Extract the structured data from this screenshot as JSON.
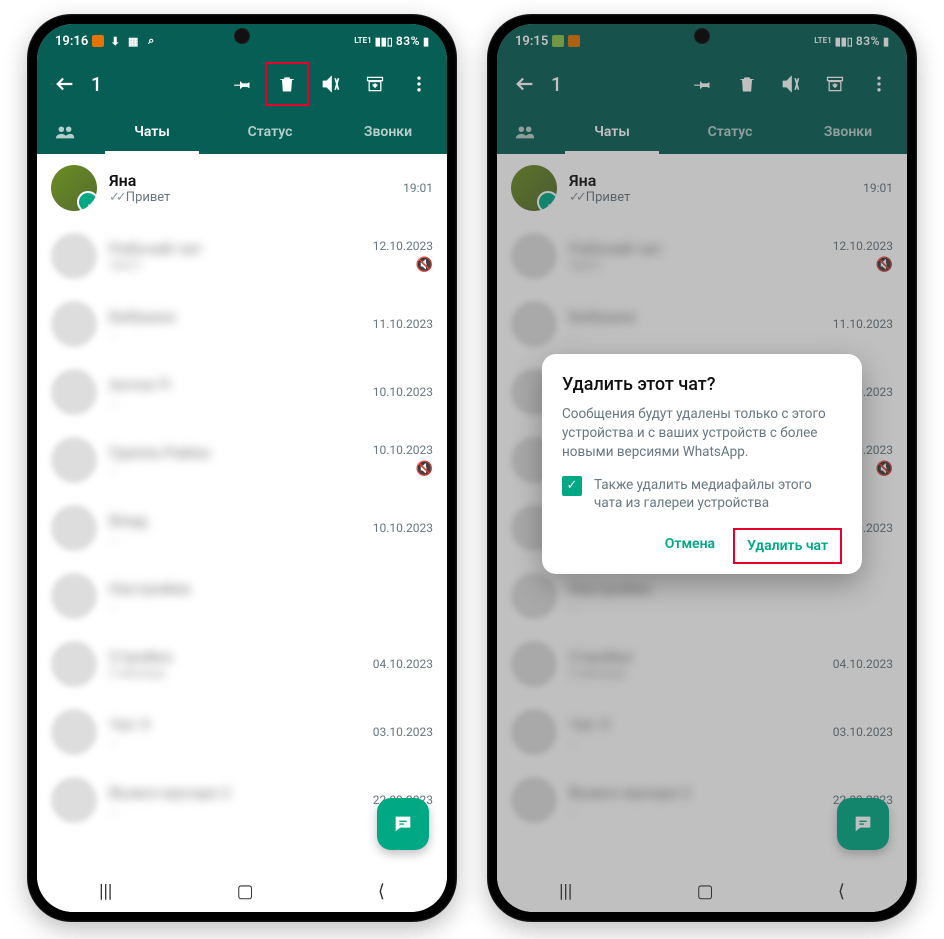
{
  "phones": [
    {
      "statusbar": {
        "time": "19:16",
        "battery": "83%",
        "net": "LTE1"
      },
      "selection_count": "1",
      "tabs": {
        "chats": "Чаты",
        "status": "Статус",
        "calls": "Звонки"
      },
      "highlight_delete": true,
      "chats": [
        {
          "name": "Яна",
          "msg": "Привет",
          "time": "19:01",
          "selected": true,
          "read": true
        },
        {
          "name": "Рабочий чат",
          "msg": "текст",
          "time": "12.10.2023",
          "muted": true,
          "blur": true
        },
        {
          "name": "Бабушка",
          "msg": "…",
          "time": "11.10.2023",
          "blur": true
        },
        {
          "name": "Антон П",
          "msg": "…",
          "time": "10.10.2023",
          "blur": true
        },
        {
          "name": "Группа Район",
          "msg": "…",
          "time": "10.10.2023",
          "muted": true,
          "blur": true
        },
        {
          "name": "Влад",
          "msg": "…",
          "time": "10.10.2023",
          "blur": true
        },
        {
          "name": "Настройки",
          "msg": "…",
          "time": "",
          "blur": true
        },
        {
          "name": "Стройка",
          "msg": "2 месяца",
          "time": "04.10.2023",
          "blur": true
        },
        {
          "name": "Чат 9",
          "msg": "…",
          "time": "03.10.2023",
          "blur": true
        },
        {
          "name": "Вывоз мусора 2",
          "msg": "…",
          "time": "22.09.2023",
          "blur": true
        }
      ]
    },
    {
      "statusbar": {
        "time": "19:15",
        "battery": "83%",
        "net": "LTE1"
      },
      "selection_count": "1",
      "tabs": {
        "chats": "Чаты",
        "status": "Статус",
        "calls": "Звонки"
      },
      "highlight_delete": false,
      "dialog": {
        "title": "Удалить этот чат?",
        "body": "Сообщения будут удалены только с этого устройства и с ваших устройств с более новыми версиями WhatsApp.",
        "checkbox": "Также удалить медиафайлы этого чата из галереи устройства",
        "cancel": "Отмена",
        "confirm": "Удалить чат"
      },
      "chats": [
        {
          "name": "Яна",
          "msg": "Привет",
          "time": "19:01",
          "selected": true,
          "read": true
        },
        {
          "name": "Рабочий чат",
          "msg": "текст",
          "time": "12.10.2023",
          "muted": true,
          "blur": true
        },
        {
          "name": "Бабушка",
          "msg": "…",
          "time": "11.10.2023",
          "blur": true
        },
        {
          "name": "Антон П",
          "msg": "…",
          "time": "10.10.2023",
          "blur": true
        },
        {
          "name": "Группа Район",
          "msg": "…",
          "time": "10.10.2023",
          "muted": true,
          "blur": true
        },
        {
          "name": "Влад",
          "msg": "…",
          "time": "10.10.2023",
          "blur": true
        },
        {
          "name": "Настройки",
          "msg": "…",
          "time": "",
          "blur": true
        },
        {
          "name": "Стройка",
          "msg": "2 месяца",
          "time": "04.10.2023",
          "blur": true
        },
        {
          "name": "Чат 9",
          "msg": "…",
          "time": "03.10.2023",
          "blur": true
        },
        {
          "name": "Вывоз мусора 2",
          "msg": "…",
          "time": "22.09.2023",
          "blur": true
        }
      ]
    }
  ],
  "icons": {
    "back": "←",
    "pin": "📌",
    "delete": "🗑",
    "mute": "🔇",
    "archive": "⬇",
    "more": "⋮",
    "people": "👥",
    "chat": "💬"
  }
}
